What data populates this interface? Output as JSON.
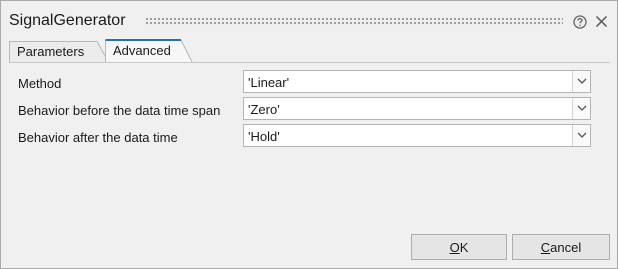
{
  "window": {
    "title": "SignalGenerator"
  },
  "titlebar_icons": [
    "help-icon",
    "close-icon"
  ],
  "tabs": [
    {
      "label": "Parameters",
      "active": false
    },
    {
      "label": "Advanced",
      "active": true
    }
  ],
  "fields": [
    {
      "label": "Method",
      "value": "'Linear'"
    },
    {
      "label": "Behavior before the data time span",
      "value": "'Zero'"
    },
    {
      "label": "Behavior after the data time",
      "value": "'Hold'"
    }
  ],
  "buttons": {
    "ok": {
      "mnemonic": "O",
      "rest": "K"
    },
    "cancel": {
      "mnemonic": "C",
      "rest": "ancel"
    }
  },
  "colors": {
    "tab_accent": "#1e73be",
    "dialog_bg": "#f0f0f0"
  }
}
